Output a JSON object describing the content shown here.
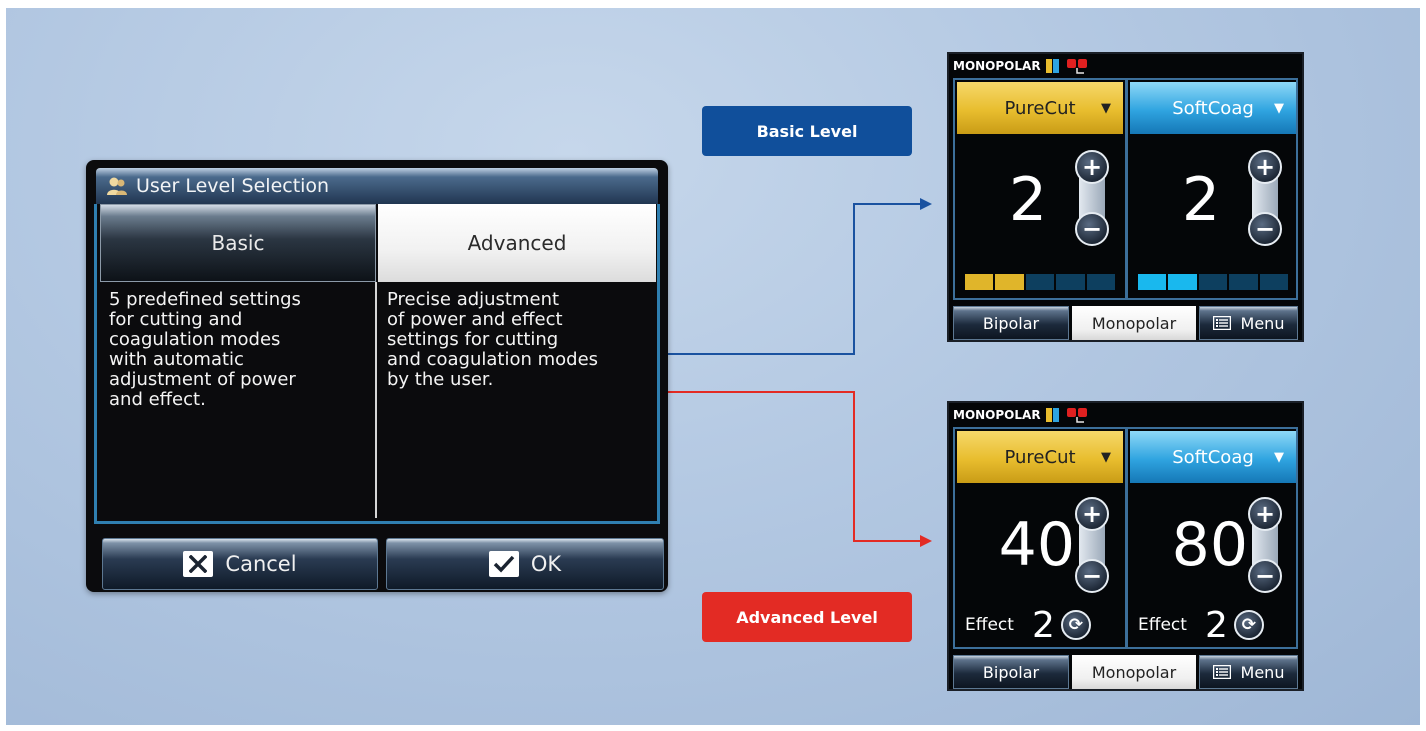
{
  "dialog": {
    "title": "User Level Selection",
    "tabs": [
      {
        "label": "Basic",
        "selected": false
      },
      {
        "label": "Advanced",
        "selected": true
      }
    ],
    "descriptions": {
      "basic": "5 predefined settings\nfor cutting and\ncoagulation modes\nwith automatic\nadjustment of power\nand effect.",
      "advanced": "Precise adjustment\nof power and effect\nsettings for cutting\nand coagulation modes\nby the user."
    },
    "buttons": {
      "cancel": "Cancel",
      "ok": "OK"
    }
  },
  "labels": {
    "basic": "Basic Level",
    "advanced": "Advanced Level"
  },
  "screen_basic": {
    "header": "MONOPOLAR",
    "left": {
      "mode": "PureCut",
      "value": "2",
      "level_segments_on": 2,
      "level_segments_total": 5
    },
    "right": {
      "mode": "SoftCoag",
      "value": "2",
      "level_segments_on": 2,
      "level_segments_total": 5
    },
    "tabs": [
      "Bipolar",
      "Monopolar",
      "Menu"
    ],
    "active_tab": "Monopolar"
  },
  "screen_advanced": {
    "header": "MONOPOLAR",
    "left": {
      "mode": "PureCut",
      "value": "40",
      "effect_label": "Effect",
      "effect_value": "2"
    },
    "right": {
      "mode": "SoftCoag",
      "value": "80",
      "effect_label": "Effect",
      "effect_value": "2"
    },
    "tabs": [
      "Bipolar",
      "Monopolar",
      "Menu"
    ],
    "active_tab": "Monopolar"
  },
  "colors": {
    "basic_label": "#104f9b",
    "advanced_label": "#e32b24",
    "cut_yellow": "#e8bd2e",
    "coag_blue": "#2fa4e0",
    "segment_yellow": "#e0b52a",
    "segment_cyan": "#19b8ee"
  }
}
